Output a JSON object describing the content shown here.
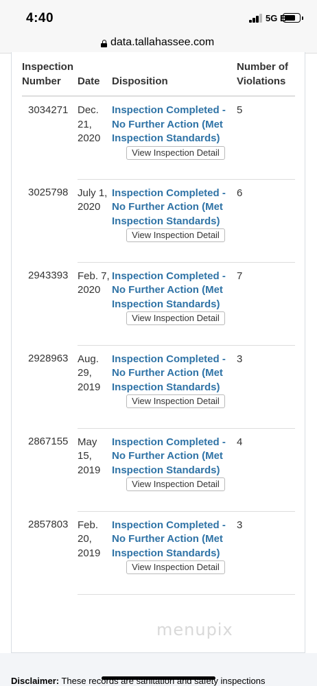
{
  "status_bar": {
    "time": "4:40",
    "network": "5G E"
  },
  "browser": {
    "url": "data.tallahassee.com"
  },
  "table": {
    "headers": {
      "inspection_number": "Inspection Number",
      "date": "Date",
      "disposition": "Disposition",
      "violations": "Number of Violations"
    },
    "button_label": "View Inspection Detail",
    "rows": [
      {
        "number": "3034271",
        "date": "Dec. 21, 2020",
        "disposition": "Inspection Completed - No Further Action (Met Inspection Standards)",
        "violations": "5"
      },
      {
        "number": "3025798",
        "date": "July 1, 2020",
        "disposition": "Inspection Completed - No Further Action (Met Inspection Standards)",
        "violations": "6"
      },
      {
        "number": "2943393",
        "date": "Feb. 7, 2020",
        "disposition": "Inspection Completed - No Further Action (Met Inspection Standards)",
        "violations": "7"
      },
      {
        "number": "2928963",
        "date": "Aug. 29, 2019",
        "disposition": "Inspection Completed - No Further Action (Met Inspection Standards)",
        "violations": "3"
      },
      {
        "number": "2867155",
        "date": "May 15, 2019",
        "disposition": "Inspection Completed - No Further Action (Met Inspection Standards)",
        "violations": "4"
      },
      {
        "number": "2857803",
        "date": "Feb. 20, 2019",
        "disposition": "Inspection Completed - No Further Action (Met Inspection Standards)",
        "violations": "3"
      }
    ]
  },
  "watermark": "menupix",
  "disclaimer": {
    "label": "Disclaimer:",
    "text": "These records are sanitation and safety inspections"
  },
  "icons": {
    "signal": "signal-icon",
    "battery": "battery-icon",
    "lock": "lock-icon"
  }
}
